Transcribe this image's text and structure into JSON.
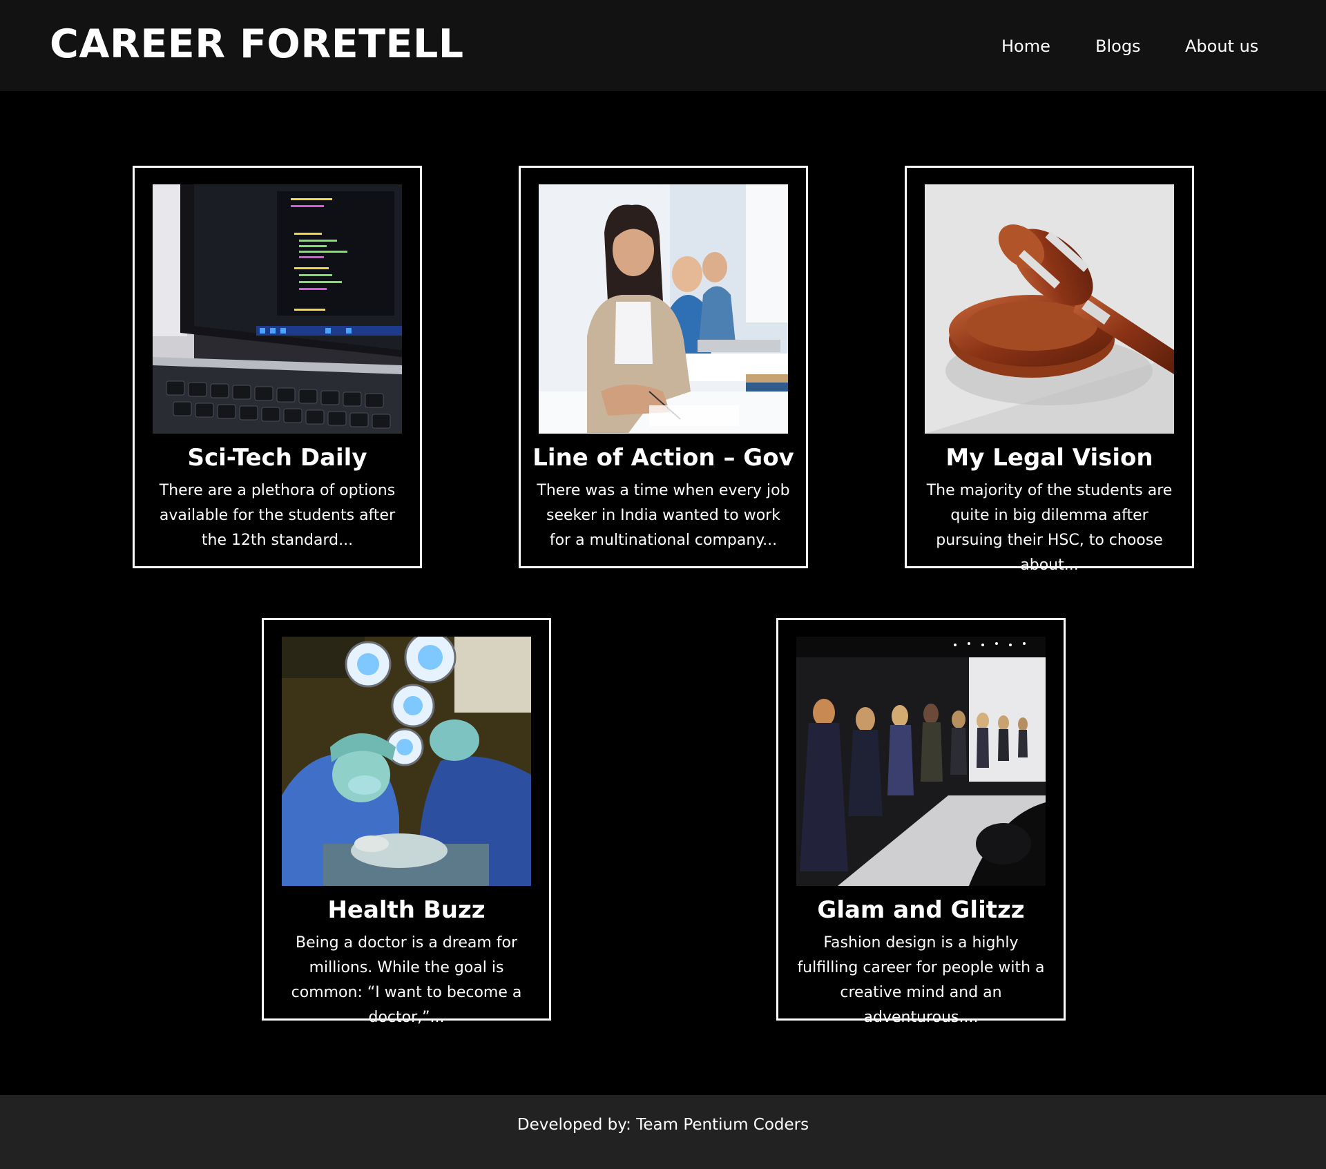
{
  "site": {
    "brand": "CAREER FORETELL"
  },
  "nav": {
    "home": "Home",
    "blogs": "Blogs",
    "about": "About us"
  },
  "cards": [
    {
      "title": "Sci-Tech Daily",
      "excerpt": "There are a plethora of options available for the students after the 12th standard...",
      "image": "laptop-code-photo"
    },
    {
      "title": "Line of Action – Gov",
      "excerpt": "There was a time when every job seeker in India wanted to work for a multinational company...",
      "image": "students-exam-photo"
    },
    {
      "title": "My Legal Vision",
      "excerpt": "The majority of the students are quite in big dilemma after pursuing their HSC, to choose about...",
      "image": "gavel-photo"
    },
    {
      "title": "Health Buzz",
      "excerpt": "Being a doctor is a dream for millions. While the goal is common: “I want to become a doctor,”...",
      "image": "surgeons-photo"
    },
    {
      "title": "Glam and Glitzz",
      "excerpt": "Fashion design is a highly fulfilling career for people with a creative mind and an adventurous....",
      "image": "fashion-runway-photo"
    }
  ],
  "footer": {
    "text": "Developed by: Team Pentium Coders"
  },
  "colors": {
    "header_bg": "#121212",
    "page_bg": "#000000",
    "footer_bg": "#222222",
    "text": "#ffffff",
    "card_border": "#ffffff"
  }
}
